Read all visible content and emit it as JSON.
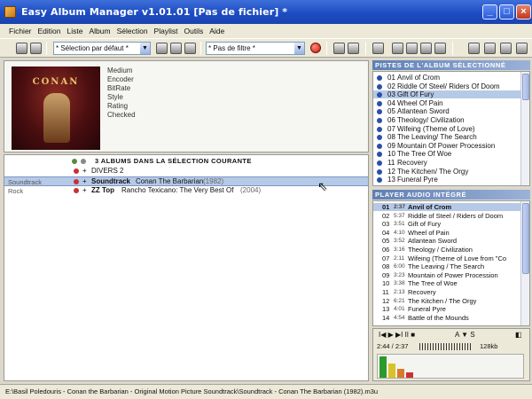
{
  "window": {
    "title": "Easy Album Manager v1.01.01 [Pas de fichier] *"
  },
  "menu": [
    "Fichier",
    "Edition",
    "Liste",
    "Album",
    "Sélection",
    "Playlist",
    "Outils",
    "Aide"
  ],
  "toolbar": {
    "selection_combo": "* Sélection par défaut *",
    "filter_combo": "* Pas de filtre *"
  },
  "album_info": {
    "cover_text": "CONAN",
    "fields": [
      "Medium",
      "Encoder",
      "BitRate",
      "Style",
      "Rating",
      "Checked"
    ]
  },
  "album_list": {
    "header": "3 ALBUMS DANS LA SÉLECTION COURANTE",
    "rows": [
      {
        "label": "",
        "text": "DIVERS 2",
        "selected": false
      },
      {
        "label": "Soundtrack",
        "text_bold": "Soundtrack",
        "text": "Conan The Barbarian",
        "year": "(1982)",
        "selected": true
      },
      {
        "label": "Rock",
        "text_bold": "ZZ Top",
        "text": "Rancho Texicano: The Very Best Of",
        "year": "(2004)",
        "selected": false
      }
    ]
  },
  "album_tracks": {
    "title": "PISTES DE L'ALBUM SÉLECTIONNÉ",
    "tracks": [
      {
        "n": "01",
        "t": "Anvil of Crom"
      },
      {
        "n": "02",
        "t": "Riddle Of Steel/ Riders Of Doom"
      },
      {
        "n": "03",
        "t": "Gift Of Fury"
      },
      {
        "n": "04",
        "t": "Wheel Of Pain"
      },
      {
        "n": "05",
        "t": "Atlantean Sword"
      },
      {
        "n": "06",
        "t": "Theology/ Civilization"
      },
      {
        "n": "07",
        "t": "Wifeing (Theme of Love)"
      },
      {
        "n": "08",
        "t": "The Leaving/ The Search"
      },
      {
        "n": "09",
        "t": "Mountain Of Power Procession"
      },
      {
        "n": "10",
        "t": "The Tree Of Woe"
      },
      {
        "n": "11",
        "t": "Recovery"
      },
      {
        "n": "12",
        "t": "The Kitchen/ The Orgy"
      },
      {
        "n": "13",
        "t": "Funeral Pyre"
      }
    ]
  },
  "player": {
    "title": "PLAYER AUDIO INTÉGRÉ",
    "tracks": [
      {
        "n": "01",
        "d": "2:37",
        "t": "Anvil of Crom"
      },
      {
        "n": "02",
        "d": "5:37",
        "t": "Riddle of Steel / Riders of Doom"
      },
      {
        "n": "03",
        "d": "3:51",
        "t": "Gift of Fury"
      },
      {
        "n": "04",
        "d": "4:10",
        "t": "Wheel of Pain"
      },
      {
        "n": "05",
        "d": "3:52",
        "t": "Atlantean Sword"
      },
      {
        "n": "06",
        "d": "3:16",
        "t": "Theology / Civilization"
      },
      {
        "n": "07",
        "d": "2:11",
        "t": "Wifeing (Theme of Love from \"Co"
      },
      {
        "n": "08",
        "d": "6:00",
        "t": "The Leaving / The Search"
      },
      {
        "n": "09",
        "d": "3:23",
        "t": "Mountain of Power Procession"
      },
      {
        "n": "10",
        "d": "3:38",
        "t": "The Tree of Woe"
      },
      {
        "n": "11",
        "d": "2:13",
        "t": "Recovery"
      },
      {
        "n": "12",
        "d": "6:21",
        "t": "The Kitchen / The Orgy"
      },
      {
        "n": "13",
        "d": "4:01",
        "t": "Funeral Pyre"
      },
      {
        "n": "14",
        "d": "4:54",
        "t": "Battle of the Mounds"
      }
    ],
    "time": "2:44 / 2:37",
    "bitrate": "128kb",
    "controls": "I◀  ▶  ▶I  II  ■",
    "controls2": "A  ▼  S"
  },
  "status": {
    "path": "E:\\Basil Poledouris - Conan the Barbarian - Original Motion Picture Soundtrack\\Soundtrack - Conan The Barbarian (1982).m3u"
  },
  "colors": {
    "titlebar": "#1d4cc2",
    "selection": "#b6c9e6",
    "pane_title": "#5f7fb4",
    "bullet": "#2a4fa8"
  }
}
